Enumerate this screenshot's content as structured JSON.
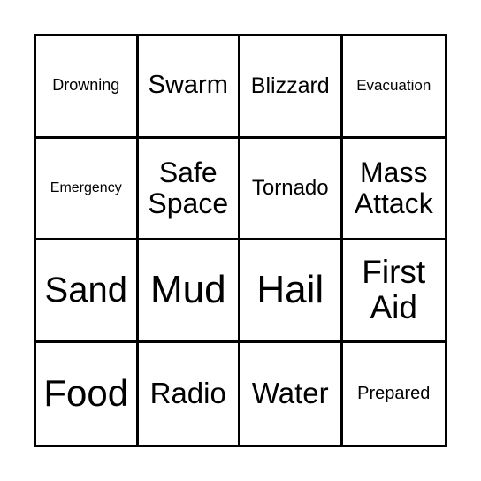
{
  "card": {
    "rows": [
      [
        {
          "text": "Drowning"
        },
        {
          "text": "Swarm"
        },
        {
          "text": "Blizzard"
        },
        {
          "text": "Evacuation"
        }
      ],
      [
        {
          "text": "Emergency"
        },
        {
          "text": "Safe Space"
        },
        {
          "text": "Tornado"
        },
        {
          "text": "Mass Attack"
        }
      ],
      [
        {
          "text": "Sand"
        },
        {
          "text": "Mud"
        },
        {
          "text": "Hail"
        },
        {
          "text": "First Aid"
        }
      ],
      [
        {
          "text": "Food"
        },
        {
          "text": "Radio"
        },
        {
          "text": "Water"
        },
        {
          "text": "Prepared"
        }
      ]
    ],
    "border_color": "#000000",
    "background_color": "#ffffff"
  }
}
